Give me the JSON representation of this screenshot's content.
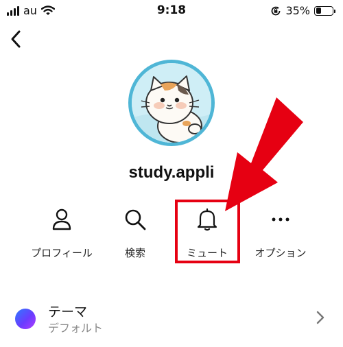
{
  "status_bar": {
    "carrier": "au",
    "time": "9:18",
    "battery_text": "35%",
    "battery_level": 0.35
  },
  "profile": {
    "username": "study.appli"
  },
  "actions": [
    {
      "label": "プロフィール",
      "icon": "person-icon"
    },
    {
      "label": "検索",
      "icon": "search-icon"
    },
    {
      "label": "ミュート",
      "icon": "bell-icon"
    },
    {
      "label": "オプション",
      "icon": "more-dots-icon"
    }
  ],
  "theme": {
    "title": "テーマ",
    "value": "デフォルト"
  },
  "annotation": {
    "highlight_color": "#e60012"
  }
}
